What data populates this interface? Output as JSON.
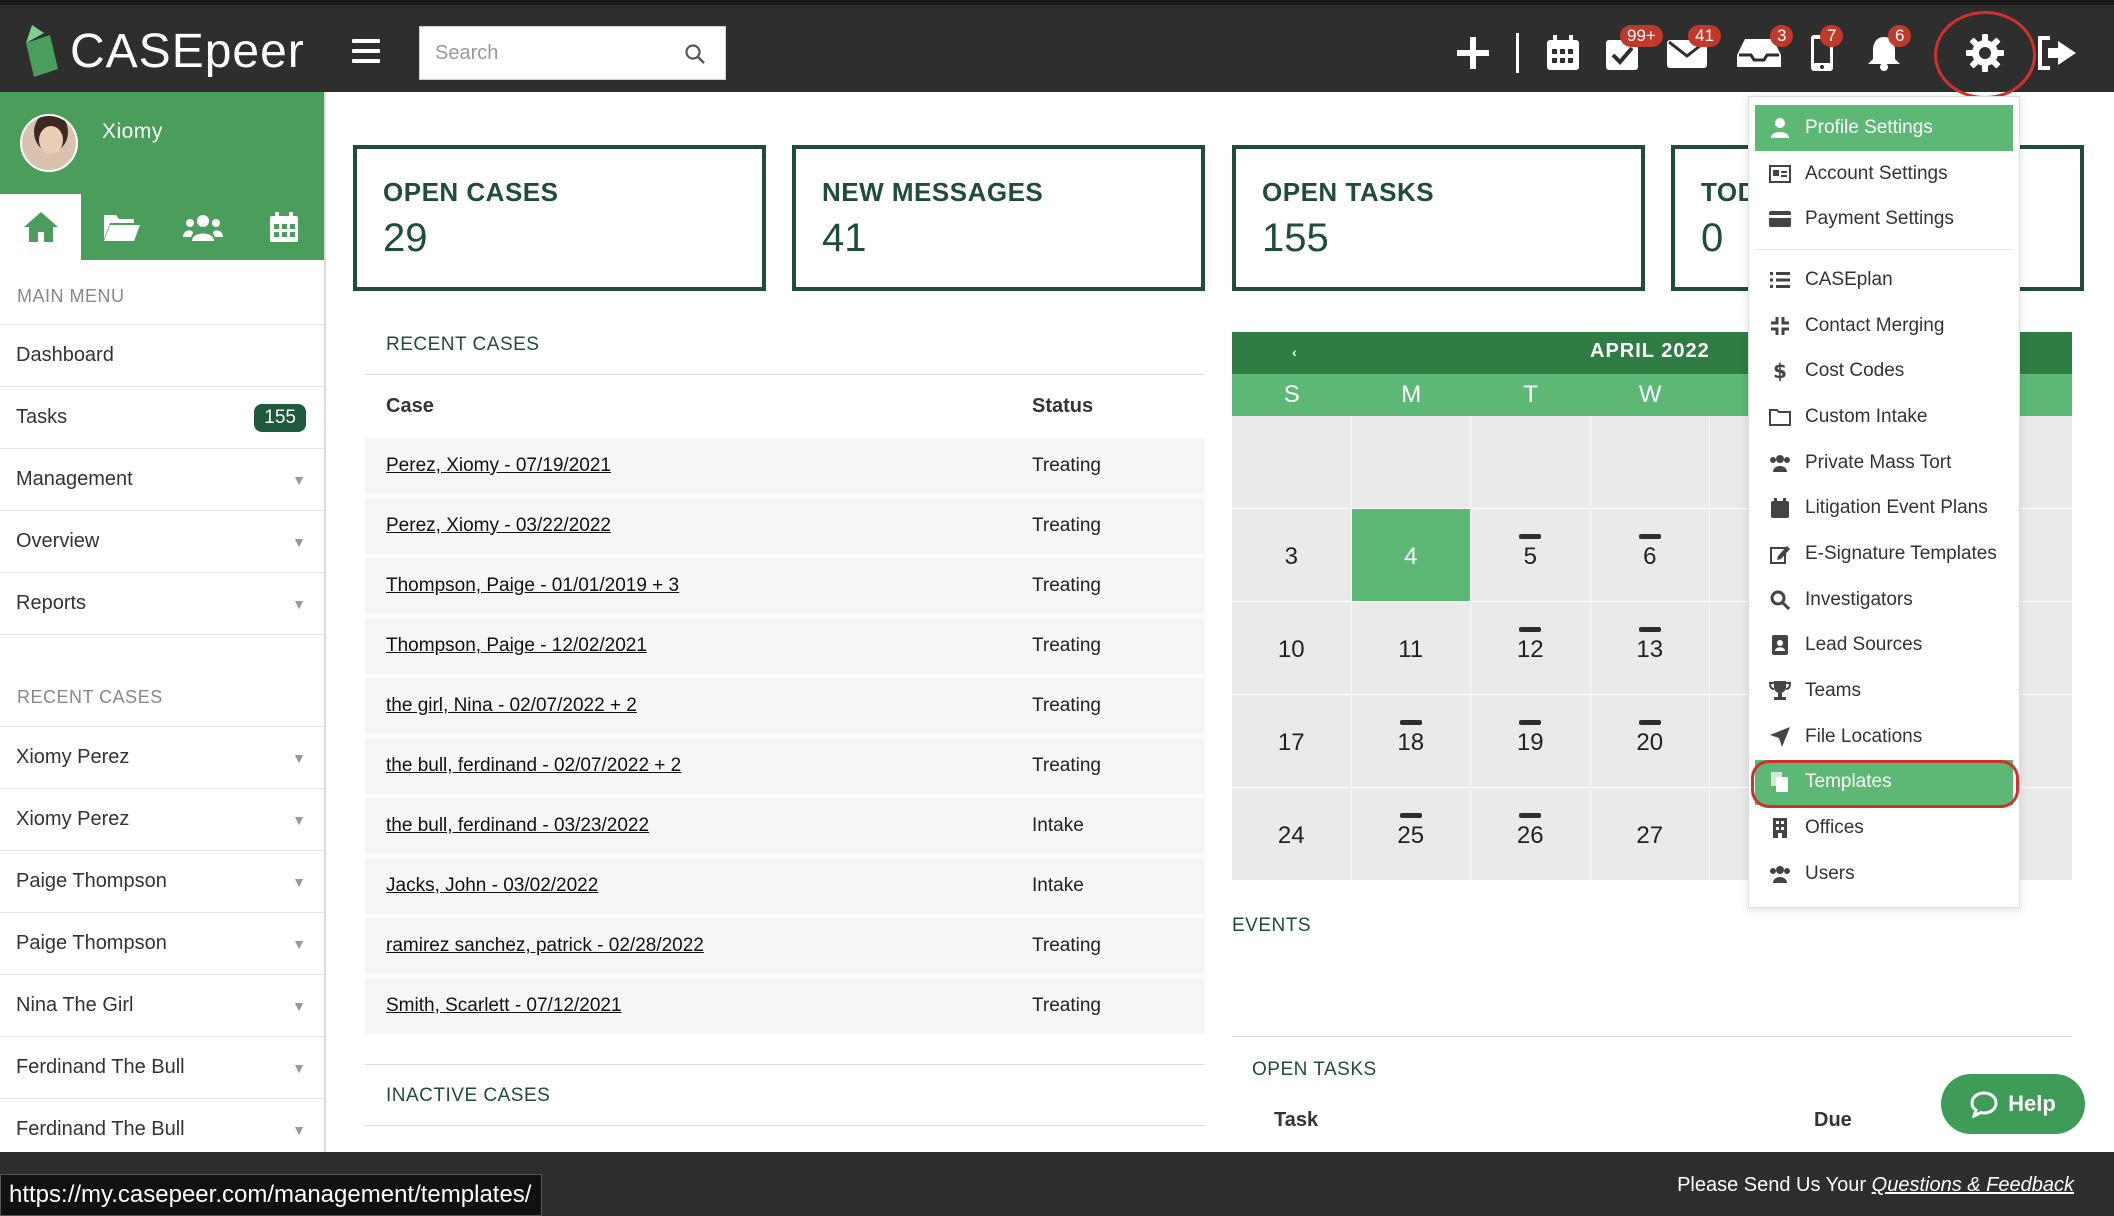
{
  "app": {
    "brand": "CASEpeer"
  },
  "search": {
    "placeholder": "Search"
  },
  "topbar": {
    "badges": {
      "tasks": "99+",
      "messages": "41",
      "inbox": "3",
      "phone": "7",
      "notifications": "6"
    }
  },
  "user": {
    "name": "Xiomy"
  },
  "sidebar": {
    "main_menu_label": "MAIN MENU",
    "main_items": [
      {
        "label": "Dashboard"
      },
      {
        "label": "Tasks",
        "count": "155"
      },
      {
        "label": "Management"
      },
      {
        "label": "Overview"
      },
      {
        "label": "Reports"
      }
    ],
    "recent_label": "RECENT CASES",
    "recent_items": [
      "Xiomy Perez",
      "Xiomy Perez",
      "Paige Thompson",
      "Paige Thompson",
      "Nina The Girl",
      "Ferdinand The Bull",
      "Ferdinand The Bull"
    ]
  },
  "cards": [
    {
      "label": "OPEN CASES",
      "value": "29"
    },
    {
      "label": "NEW MESSAGES",
      "value": "41"
    },
    {
      "label": "OPEN TASKS",
      "value": "155"
    },
    {
      "label": "TOD",
      "value": "0"
    }
  ],
  "recent_cases": {
    "title": "RECENT CASES",
    "col_case": "Case",
    "col_status": "Status",
    "rows": [
      {
        "case": "Perez, Xiomy - 07/19/2021",
        "status": "Treating"
      },
      {
        "case": "Perez, Xiomy - 03/22/2022",
        "status": "Treating"
      },
      {
        "case": "Thompson, Paige - 01/01/2019 + 3",
        "status": "Treating"
      },
      {
        "case": "Thompson, Paige - 12/02/2021",
        "status": "Treating"
      },
      {
        "case": "the girl, Nina - 02/07/2022 + 2",
        "status": "Treating"
      },
      {
        "case": "the bull, ferdinand - 02/07/2022 + 2",
        "status": "Treating"
      },
      {
        "case": "the bull, ferdinand - 03/23/2022",
        "status": "Intake"
      },
      {
        "case": "Jacks, John - 03/02/2022",
        "status": "Intake"
      },
      {
        "case": "ramirez sanchez, patrick - 02/28/2022",
        "status": "Treating"
      },
      {
        "case": "Smith, Scarlett - 07/12/2021",
        "status": "Treating"
      }
    ]
  },
  "inactive_cases": {
    "title": "INACTIVE CASES"
  },
  "calendar": {
    "prev": "‹",
    "month": "APRIL 2022",
    "day_names": [
      "S",
      "M",
      "T",
      "W"
    ],
    "weeks": [
      [
        {
          "d": ""
        },
        {
          "d": ""
        },
        {
          "d": ""
        },
        {
          "d": ""
        }
      ],
      [
        {
          "d": "3"
        },
        {
          "d": "4",
          "today": true
        },
        {
          "d": "5",
          "ev": true
        },
        {
          "d": "6",
          "ev": true
        }
      ],
      [
        {
          "d": "10"
        },
        {
          "d": "11"
        },
        {
          "d": "12",
          "ev": true
        },
        {
          "d": "13",
          "ev": true
        }
      ],
      [
        {
          "d": "17"
        },
        {
          "d": "18",
          "ev": true
        },
        {
          "d": "19",
          "ev": true
        },
        {
          "d": "20",
          "ev": true
        }
      ],
      [
        {
          "d": "24"
        },
        {
          "d": "25",
          "ev": true
        },
        {
          "d": "26",
          "ev": true
        },
        {
          "d": "27"
        }
      ]
    ]
  },
  "settings_menu": {
    "group1": [
      {
        "label": "Profile Settings",
        "icon": "user-icon",
        "active": true
      },
      {
        "label": "Account Settings",
        "icon": "id-card-icon"
      },
      {
        "label": "Payment Settings",
        "icon": "credit-card-icon"
      }
    ],
    "group2": [
      {
        "label": "CASEplan",
        "icon": "list-icon"
      },
      {
        "label": "Contact Merging",
        "icon": "compress-icon"
      },
      {
        "label": "Cost Codes",
        "icon": "dollar-icon"
      },
      {
        "label": "Custom Intake",
        "icon": "folder-icon"
      },
      {
        "label": "Private Mass Tort",
        "icon": "users-icon"
      },
      {
        "label": "Litigation Event Plans",
        "icon": "calendar-icon"
      },
      {
        "label": "E-Signature Templates",
        "icon": "edit-icon"
      },
      {
        "label": "Investigators",
        "icon": "search-icon"
      },
      {
        "label": "Lead Sources",
        "icon": "contact-book-icon"
      },
      {
        "label": "Teams",
        "icon": "trophy-icon"
      },
      {
        "label": "File Locations",
        "icon": "location-arrow-icon"
      },
      {
        "label": "Templates",
        "icon": "copy-icon",
        "active": true
      },
      {
        "label": "Offices",
        "icon": "building-icon"
      },
      {
        "label": "Users",
        "icon": "users-icon"
      }
    ]
  },
  "events": {
    "title": "EVENTS"
  },
  "open_tasks": {
    "title": "OPEN TASKS",
    "col_task": "Task",
    "col_due": "Due"
  },
  "help": {
    "label": "Help"
  },
  "footer": {
    "text": "Please Send Us Your ",
    "link": "Questions & Feedback"
  },
  "status_url": "https://my.casepeer.com/management/templates/",
  "colors": {
    "accent": "#5cb874",
    "dark_green": "#1f4d3a",
    "topbar": "#2e2e2e",
    "badge": "#c0392b",
    "highlight_ring": "#d0312d"
  }
}
